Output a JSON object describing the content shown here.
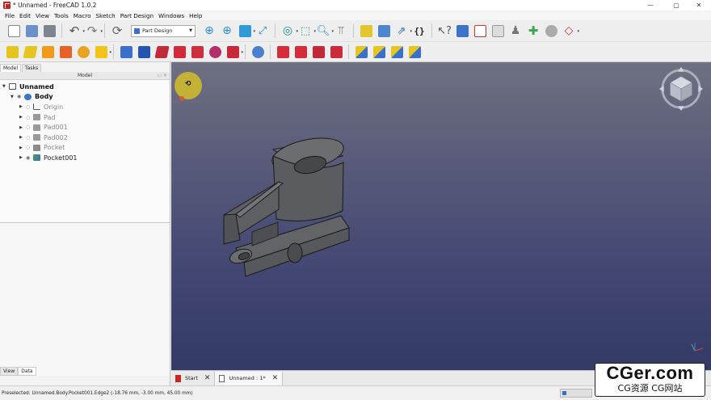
{
  "window": {
    "title": "* Unnamed - FreeCAD 1.0.2",
    "controls": [
      "—",
      "▢",
      "✕"
    ]
  },
  "menu": [
    "File",
    "Edit",
    "View",
    "Tools",
    "Macro",
    "Sketch",
    "Part Design",
    "Windows",
    "Help"
  ],
  "workbench_selector": {
    "value": "Part Design"
  },
  "colors": {
    "viewport_top": "#6f7082",
    "viewport_bottom": "#333a66",
    "part": "#5c5e62",
    "accent": "#3a6fc8"
  },
  "combo_view": {
    "tabs": [
      "Model",
      "Tasks"
    ],
    "header": "Model",
    "tree": [
      {
        "label": "Unnamed",
        "level": 0,
        "icon": "document-icon"
      },
      {
        "label": "Body",
        "level": 1,
        "icon": "body-icon"
      },
      {
        "label": "Origin",
        "level": 2,
        "icon": "origin-icon"
      },
      {
        "label": "Pad",
        "level": 2,
        "icon": "pad-icon"
      },
      {
        "label": "Pad001",
        "level": 2,
        "icon": "pad-icon"
      },
      {
        "label": "Pad002",
        "level": 2,
        "icon": "pad-icon"
      },
      {
        "label": "Pocket",
        "level": 2,
        "icon": "pocket-icon"
      },
      {
        "label": "Pocket001",
        "level": 2,
        "icon": "pocket-icon"
      }
    ],
    "bottom_tabs": [
      "View",
      "Data"
    ]
  },
  "document_tabs": [
    {
      "label": "Start"
    },
    {
      "label": "Unnamed : 1*"
    }
  ],
  "status": {
    "text": "Preselected: Unnamed.Body.Pocket001.Edge2 (-18.76 mm, -3.00 mm, 45.00 mm)"
  },
  "watermark": {
    "main": "CGer.com",
    "sub": "CG资源 CG网站"
  }
}
